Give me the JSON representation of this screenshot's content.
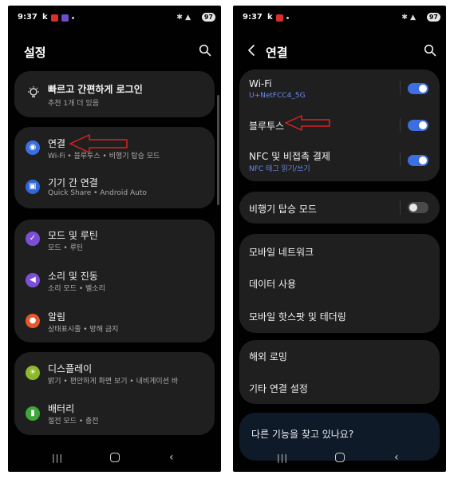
{
  "status": {
    "time": "9:37",
    "k": "k",
    "battery": "97"
  },
  "left": {
    "title": "설정",
    "login": {
      "title": "빠르고 간편하게 로그인",
      "sub": "추천 1개 더 있음"
    },
    "items": [
      {
        "title": "연결",
        "sub": "Wi-Fi • 블루투스 • 비행기 탑승 모드",
        "color": "#3b6fe0"
      },
      {
        "title": "기기 간 연결",
        "sub": "Quick Share • Android Auto",
        "color": "#2f67d8"
      },
      {
        "title": "모드 및 루틴",
        "sub": "모드 • 루틴",
        "color": "#7a4ed6"
      },
      {
        "title": "소리 및 진동",
        "sub": "소리 모드 • 벨소리",
        "color": "#7c4ed8"
      },
      {
        "title": "알림",
        "sub": "상태표시줄 • 방해 금지",
        "color": "#e6572c"
      },
      {
        "title": "디스플레이",
        "sub": "밝기 • 편안하게 화면 보기 • 내비게이션 바",
        "color": "#8db82a"
      },
      {
        "title": "배터리",
        "sub": "절전 모드 • 충전",
        "color": "#3ea63a"
      }
    ]
  },
  "right": {
    "title": "연결",
    "wifi": {
      "title": "Wi-Fi",
      "sub": "U+NetFCC4_5G",
      "on": true
    },
    "bluetooth": {
      "title": "블루투스",
      "on": true
    },
    "nfc": {
      "title": "NFC 및 비접촉 결제",
      "sub": "NFC 태그 읽기/쓰기",
      "on": true
    },
    "airplane": {
      "title": "비행기 탑승 모드",
      "on": false
    },
    "group3": [
      "모바일 네트워크",
      "데이터 사용",
      "모바일 핫스팟 및 테더링"
    ],
    "group4": [
      "해외 로밍",
      "기타 연결 설정"
    ],
    "hint": "다른 기능을 찾고 있나요?"
  },
  "colors": {
    "accent": "#3e6fe0",
    "arrow": "#e02020",
    "card": "#1f1f1f"
  }
}
